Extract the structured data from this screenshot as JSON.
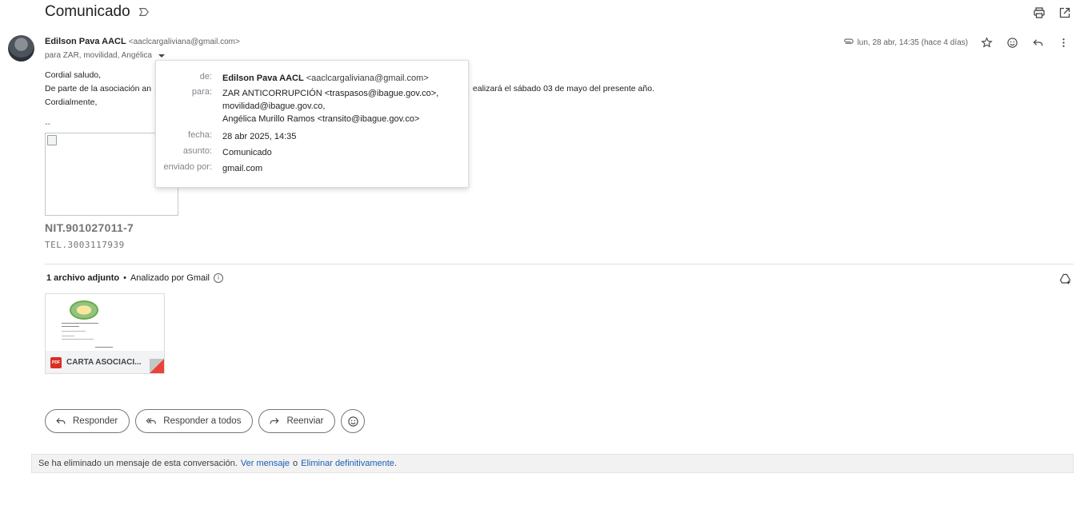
{
  "subject": "Comunicado",
  "sender": {
    "name": "Edilson Pava AACL",
    "email": "<aaclcargaliviana@gmail.com>",
    "recipients": "para ZAR, movilidad, Angélica",
    "date": "lun, 28 abr, 14:35 (hace 4 días)"
  },
  "body": {
    "greeting": "Cordial saludo,",
    "line_start": "De parte de la asociación an",
    "line_end": "ealizará el sábado 03 de mayo del presente año.",
    "closing": "Cordialmente,",
    "dashes": "--",
    "nit": "NIT.901027011-7",
    "tel": "TEL.3003117939"
  },
  "details_popup": {
    "from_label": "de:",
    "from_name": "Edilson Pava AACL",
    "from_email": "<aaclcargaliviana@gmail.com>",
    "to_label": "para:",
    "to_line1": "ZAR ANTICORRUPCIÓN <traspasos@ibague.gov.co>,",
    "to_line2": "movilidad@ibague.gov.co,",
    "to_line3": "Angélica Murillo Ramos <transito@ibague.gov.co>",
    "date_label": "fecha:",
    "date_value": "28 abr 2025, 14:35",
    "subject_label": "asunto:",
    "subject_value": "Comunicado",
    "sent_by_label": "enviado por:",
    "sent_by_value": "gmail.com"
  },
  "attachments": {
    "header_count": "1 archivo adjunto",
    "header_sep": "•",
    "scanned": "Analizado por Gmail",
    "files": [
      {
        "name": "CARTA ASOCIACI...",
        "type_badge": "PDF"
      }
    ]
  },
  "reply_actions": {
    "reply": "Responder",
    "reply_all": "Responder a todos",
    "forward": "Reenviar"
  },
  "deleted_notice": {
    "text": "Se ha eliminado un mensaje de esta conversación.",
    "view": "Ver mensaje",
    "or": "o",
    "delete": "Eliminar definitivamente",
    "period": "."
  },
  "colors": {
    "link": "#1a5fb4",
    "pdf_red": "#d93025"
  }
}
